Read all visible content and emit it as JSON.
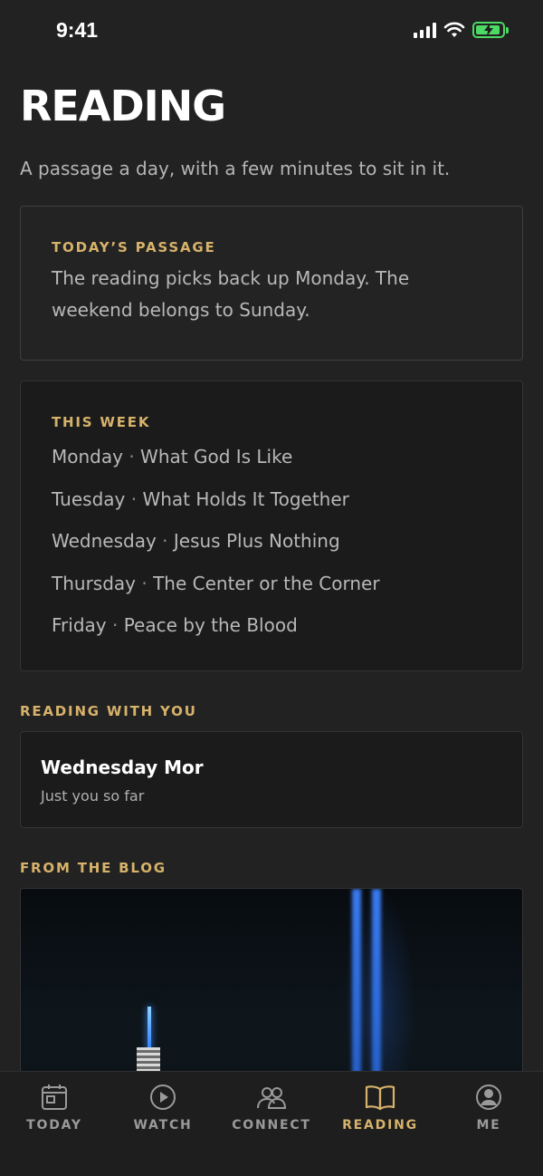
{
  "status_bar": {
    "time": "9:41"
  },
  "header": {
    "title": "READING",
    "subtitle": "A passage a day, with a few minutes to sit in it."
  },
  "todays_passage": {
    "label": "TODAY’S PASSAGE",
    "text_line1": "The reading picks back up Monday. The",
    "text_line2": "weekend belongs to Sunday."
  },
  "this_week": {
    "label": "THIS WEEK",
    "separator": "·",
    "days": [
      {
        "day": "Monday",
        "title": "What God Is Like"
      },
      {
        "day": "Tuesday",
        "title": "What Holds It Together"
      },
      {
        "day": "Wednesday",
        "title": "Jesus Plus Nothing"
      },
      {
        "day": "Thursday",
        "title": "The Center or the Corner"
      },
      {
        "day": "Friday",
        "title": "Peace by the Blood"
      }
    ]
  },
  "reading_with_you": {
    "label": "READING WITH YOU",
    "group_name": "Wednesday Mor",
    "members": "Just you so far"
  },
  "blog": {
    "label": "FROM THE BLOG"
  },
  "tab_bar": {
    "active_color": "#d7b26a",
    "inactive_color": "#9a9a9a",
    "tabs": [
      {
        "label": "TODAY",
        "icon": "calendar-icon",
        "active": false
      },
      {
        "label": "WATCH",
        "icon": "play-circle-icon",
        "active": false
      },
      {
        "label": "CONNECT",
        "icon": "people-icon",
        "active": false
      },
      {
        "label": "READING",
        "icon": "book-icon",
        "active": true
      },
      {
        "label": "ME",
        "icon": "profile-icon",
        "active": false
      }
    ]
  },
  "colors": {
    "background": "#222222",
    "accent": "#d7b26a",
    "battery": "#4cd964"
  }
}
